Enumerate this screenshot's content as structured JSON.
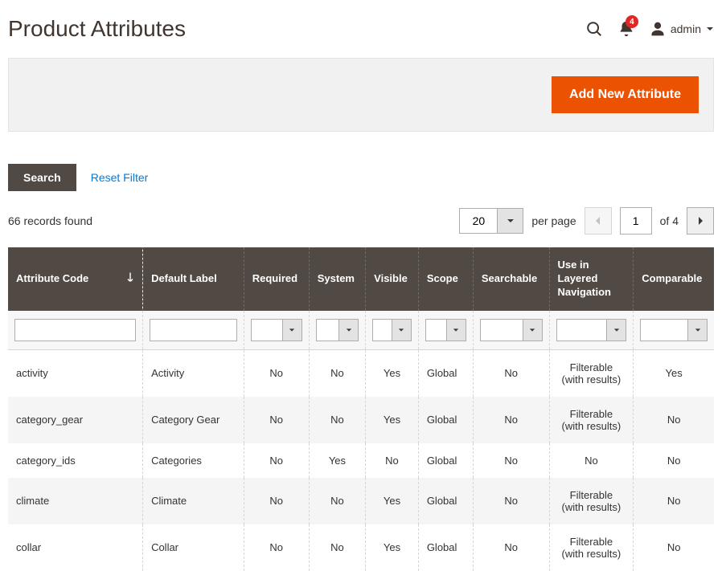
{
  "header": {
    "title": "Product Attributes",
    "notification_count": "4",
    "admin_label": "admin"
  },
  "actions": {
    "add_button": "Add New Attribute"
  },
  "filter": {
    "search_label": "Search",
    "reset_label": "Reset Filter"
  },
  "pager": {
    "records_text": "66 records found",
    "per_page_value": "20",
    "per_page_label": "per page",
    "current_page": "1",
    "total_pages_text": "of 4"
  },
  "columns": [
    "Attribute Code",
    "Default Label",
    "Required",
    "System",
    "Visible",
    "Scope",
    "Searchable",
    "Use in Layered Navigation",
    "Comparable"
  ],
  "rows": [
    {
      "code": "activity",
      "label": "Activity",
      "required": "No",
      "system": "No",
      "visible": "Yes",
      "scope": "Global",
      "searchable": "No",
      "layered": "Filterable (with results)",
      "comparable": "Yes"
    },
    {
      "code": "category_gear",
      "label": "Category Gear",
      "required": "No",
      "system": "No",
      "visible": "Yes",
      "scope": "Global",
      "searchable": "No",
      "layered": "Filterable (with results)",
      "comparable": "No"
    },
    {
      "code": "category_ids",
      "label": "Categories",
      "required": "No",
      "system": "Yes",
      "visible": "No",
      "scope": "Global",
      "searchable": "No",
      "layered": "No",
      "comparable": "No"
    },
    {
      "code": "climate",
      "label": "Climate",
      "required": "No",
      "system": "No",
      "visible": "Yes",
      "scope": "Global",
      "searchable": "No",
      "layered": "Filterable (with results)",
      "comparable": "No"
    },
    {
      "code": "collar",
      "label": "Collar",
      "required": "No",
      "system": "No",
      "visible": "Yes",
      "scope": "Global",
      "searchable": "No",
      "layered": "Filterable (with results)",
      "comparable": "No"
    }
  ]
}
